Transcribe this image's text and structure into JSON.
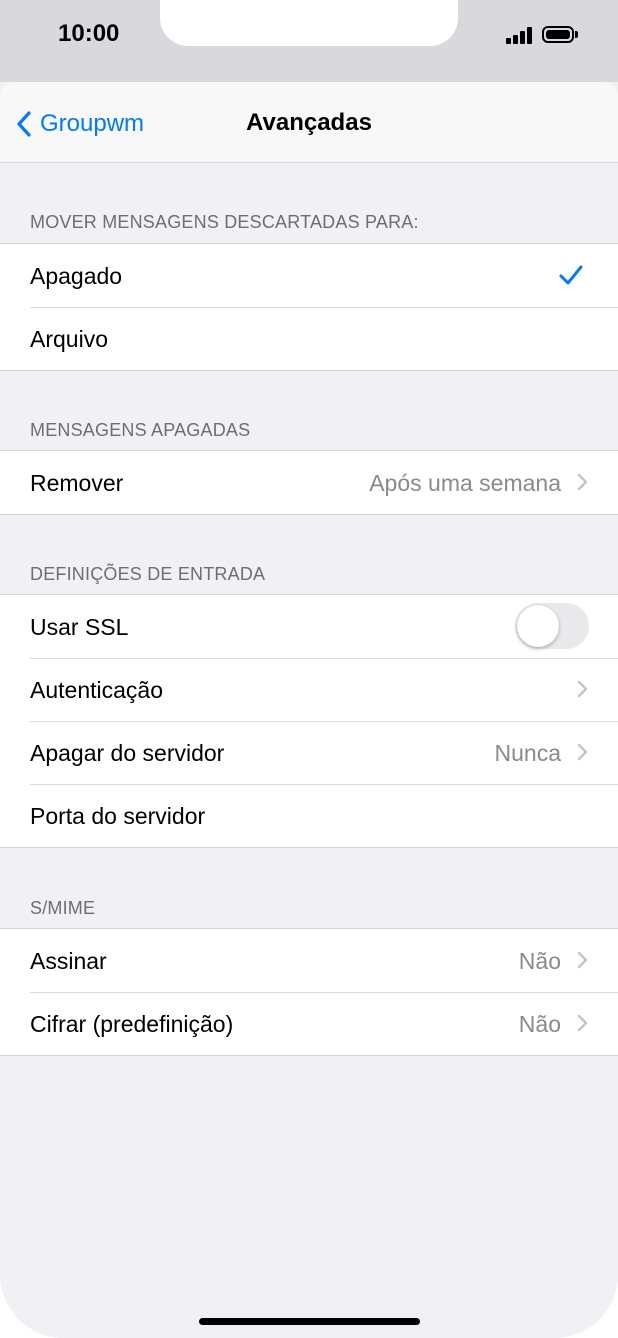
{
  "status_bar": {
    "time": "10:00"
  },
  "nav": {
    "back_label": "Groupwm",
    "title": "Avançadas"
  },
  "sections": [
    {
      "header": "MOVER MENSAGENS DESCARTADAS PARA:",
      "rows": [
        {
          "label": "Apagado",
          "checked": true
        },
        {
          "label": "Arquivo"
        }
      ]
    },
    {
      "header": "MENSAGENS APAGADAS",
      "rows": [
        {
          "label": "Remover",
          "value": "Após uma semana"
        }
      ]
    },
    {
      "header": "DEFINIÇÕES DE ENTRADA",
      "rows": [
        {
          "label": "Usar SSL",
          "toggle_on": false
        },
        {
          "label": "Autenticação"
        },
        {
          "label": "Apagar do servidor",
          "value": "Nunca"
        },
        {
          "label": "Porta do servidor"
        }
      ]
    },
    {
      "header": "S/MIME",
      "rows": [
        {
          "label": "Assinar",
          "value": "Não"
        },
        {
          "label": "Cifrar (predefinição)",
          "value": "Não"
        }
      ]
    }
  ],
  "colors": {
    "accent": "#007aff",
    "background": "#f0f0f5",
    "secondary_text": "#8a8a8e"
  }
}
